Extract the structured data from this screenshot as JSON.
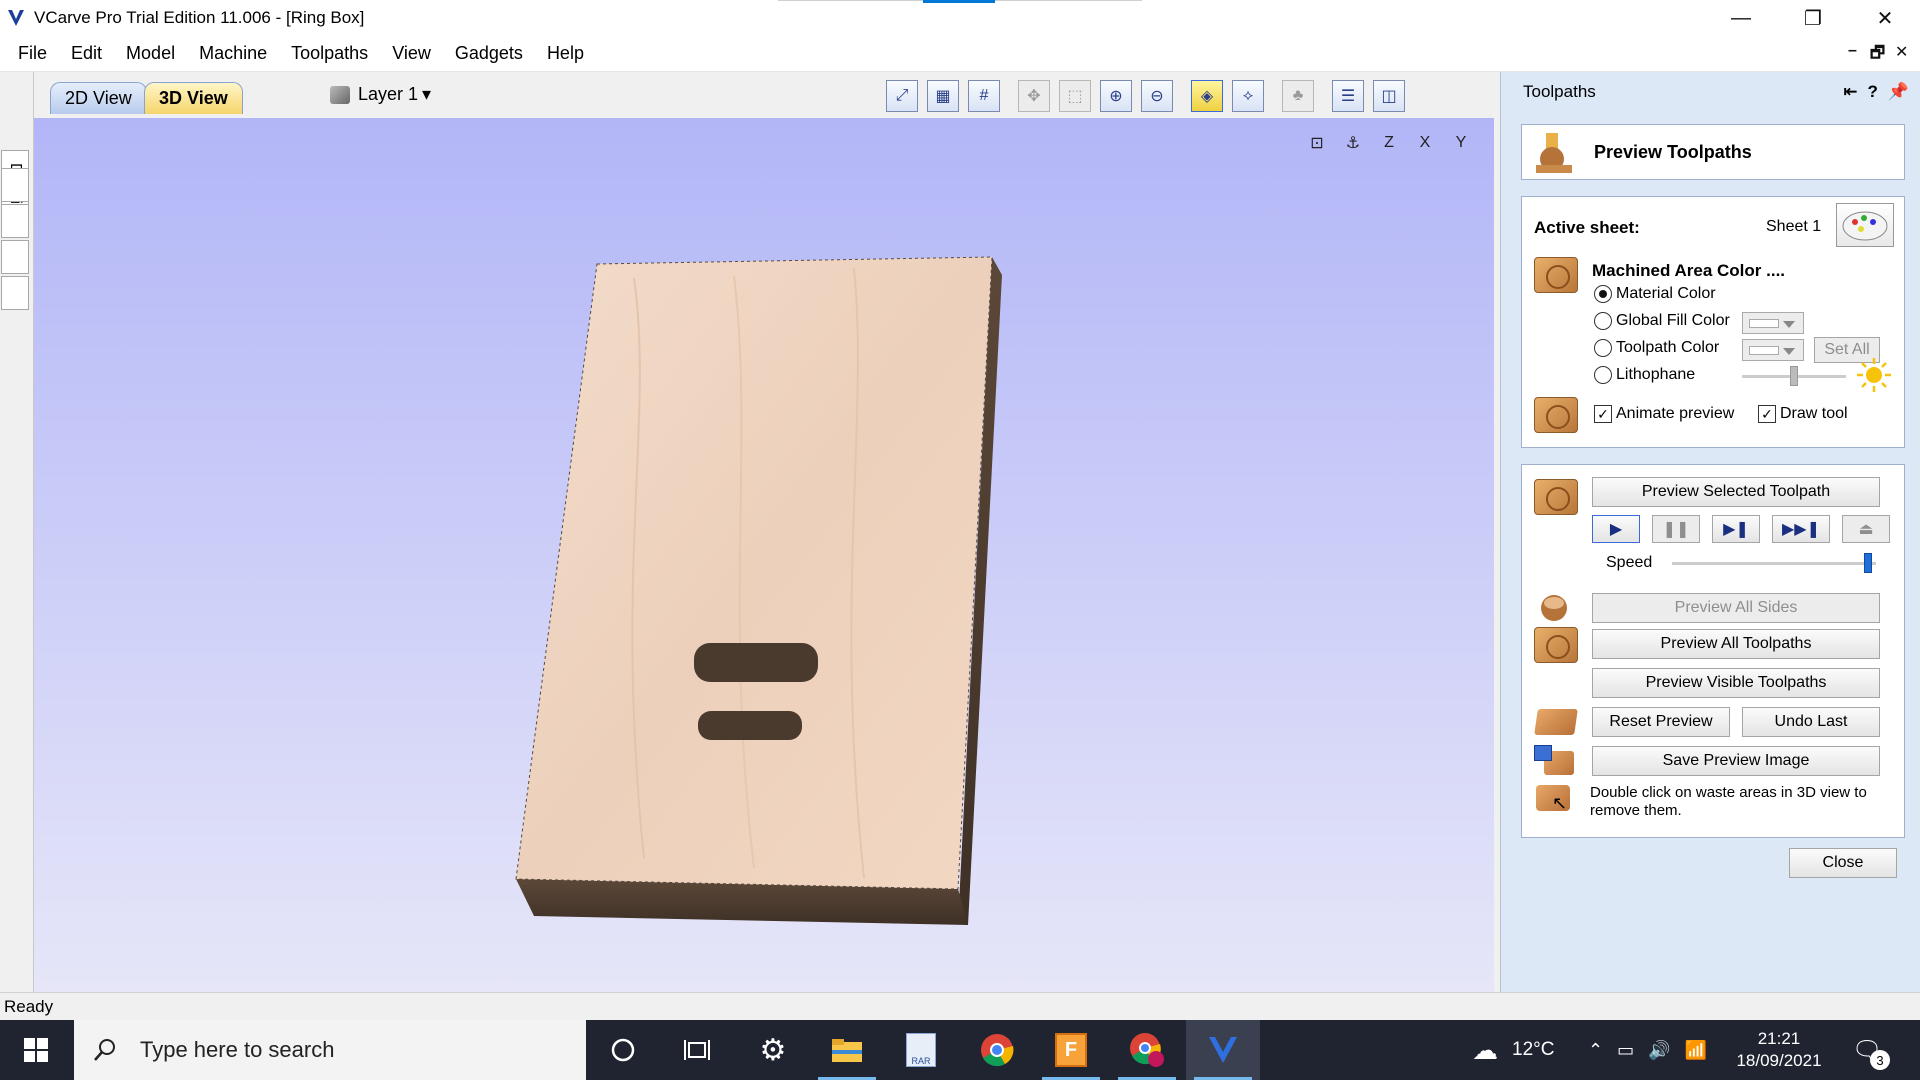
{
  "window": {
    "title": "VCarve Pro Trial Edition 11.006 - [Ring Box]",
    "controls": {
      "minimize": "—",
      "restore": "❐",
      "close": "✕"
    }
  },
  "menu": [
    "File",
    "Edit",
    "Model",
    "Machine",
    "Toolpaths",
    "View",
    "Gadgets",
    "Help"
  ],
  "mdi_controls": {
    "minimize": "–",
    "restore": "🗗",
    "close": "✕"
  },
  "side_tabs": {
    "drawing": "Drawing"
  },
  "view_tabs": {
    "two_d": "2D View",
    "three_d": "3D View"
  },
  "layer": {
    "label": "Layer 1",
    "arrow": "▾"
  },
  "panel": {
    "title": "Toolpaths",
    "header_icons": {
      "help": "?",
      "pin": "📌"
    },
    "preview_title": "Preview Toolpaths",
    "active_sheet_label": "Active sheet:",
    "active_sheet_value": "Sheet 1",
    "machined_title": "Machined Area Color ....",
    "radios": [
      {
        "label": "Material Color",
        "selected": true
      },
      {
        "label": "Global Fill Color",
        "selected": false
      },
      {
        "label": "Toolpath Color",
        "selected": false
      },
      {
        "label": "Lithophane",
        "selected": false
      }
    ],
    "set_all": "Set All",
    "animate_preview": "Animate preview",
    "draw_tool": "Draw tool",
    "preview_selected": "Preview Selected Toolpath",
    "speed_label": "Speed",
    "speed_value": 0.98,
    "preview_all_sides": "Preview All Sides",
    "preview_all_toolpaths": "Preview All Toolpaths",
    "preview_visible_toolpaths": "Preview Visible Toolpaths",
    "reset_preview": "Reset Preview",
    "undo_last": "Undo Last",
    "save_preview_image": "Save Preview Image",
    "hint": "Double click on waste areas in 3D view to remove them.",
    "close": "Close"
  },
  "status": {
    "text": "Ready"
  },
  "taskbar": {
    "search_placeholder": "Type here to search",
    "temperature": "12°C",
    "time": "21:21",
    "date": "18/09/2021",
    "notification_count": "3"
  }
}
